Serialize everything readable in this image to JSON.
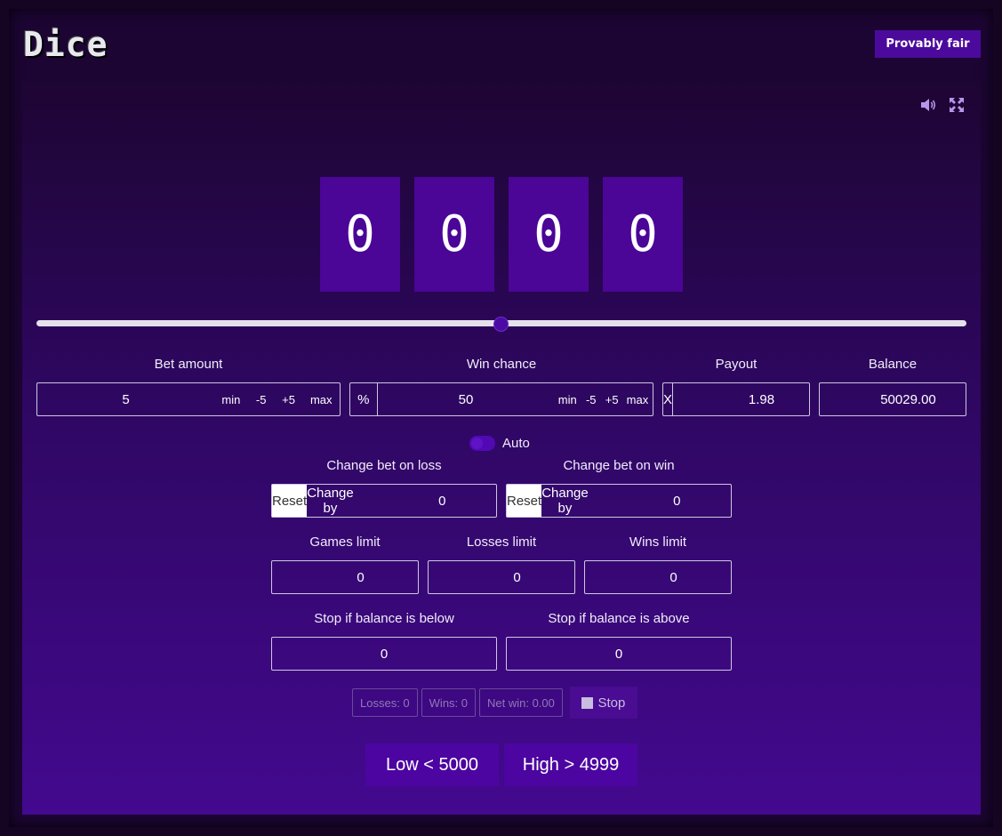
{
  "header": {
    "logo": "Dice",
    "provably_fair": "Provably fair",
    "icons": [
      "volume-icon",
      "fullscreen-icon"
    ]
  },
  "digits": [
    "0",
    "0",
    "0",
    "0"
  ],
  "slider": {
    "value_fraction": 0.5
  },
  "bet_amount": {
    "label": "Bet amount",
    "value": "5",
    "buttons": {
      "min": "min",
      "minus": "-5",
      "plus": "+5",
      "max": "max"
    }
  },
  "win_chance": {
    "label": "Win chance",
    "prefix": "%",
    "value": "50",
    "buttons": {
      "min": "min",
      "minus": "-5",
      "plus": "+5",
      "max": "max"
    }
  },
  "payout": {
    "label": "Payout",
    "prefix": "X",
    "value": "1.98"
  },
  "balance": {
    "label": "Balance",
    "value": "50029.00"
  },
  "auto": {
    "label": "Auto"
  },
  "change_on_loss": {
    "label": "Change bet on loss",
    "reset": "Reset",
    "change_by": "Change by",
    "value": "0"
  },
  "change_on_win": {
    "label": "Change bet on win",
    "reset": "Reset",
    "change_by": "Change by",
    "value": "0"
  },
  "limits": {
    "games": {
      "label": "Games limit",
      "value": "0"
    },
    "losses": {
      "label": "Losses limit",
      "value": "0"
    },
    "wins": {
      "label": "Wins limit",
      "value": "0"
    }
  },
  "stop_balance": {
    "below": {
      "label": "Stop if balance is below",
      "value": "0"
    },
    "above": {
      "label": "Stop if balance is above",
      "value": "0"
    }
  },
  "stats": {
    "losses": "Losses: 0",
    "wins": "Wins: 0",
    "net_win": "Net win: 0.00",
    "stop": "Stop"
  },
  "bets": {
    "low": "Low < 5000",
    "high": "High > 4999"
  },
  "colors": {
    "background": "#150422",
    "digit_bg": "#4b0597",
    "accent": "#4b0a9c",
    "button_bg": "#4c05a1"
  }
}
